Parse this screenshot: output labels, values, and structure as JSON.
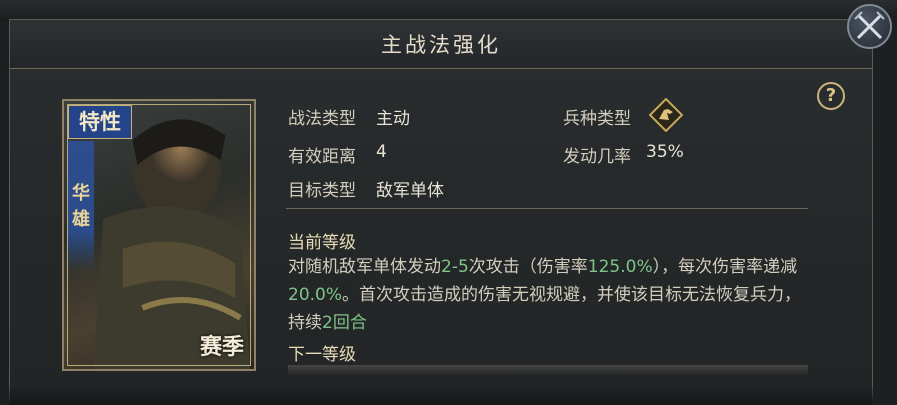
{
  "dialog": {
    "title": "主战法强化"
  },
  "card": {
    "trait": "特性",
    "name": "华雄",
    "season": "赛季"
  },
  "stats": {
    "tactic_type_label": "战法类型",
    "tactic_type_value": "主动",
    "range_label": "有效距离",
    "range_value": "4",
    "target_label": "目标类型",
    "target_value": "敌军单体",
    "troop_type_label": "兵种类型",
    "troop_type_icon": "troop-type-icon",
    "trigger_rate_label": "发动几率",
    "trigger_rate_value": "35%"
  },
  "current_level": {
    "heading": "当前等级",
    "desc_parts": [
      "对随机敌军单体发动",
      "2-5",
      "次攻击（伤害率",
      "125.0%",
      "），每次伤害率递减",
      "20.0%",
      "。首次攻击造成的伤害无视规避，并使该目标无法恢复兵力，持续",
      "2回合"
    ]
  },
  "next_level": {
    "heading": "下一等级"
  },
  "colors": {
    "highlight": "#7fc48b",
    "accent": "#d9c48a",
    "badge": "#24448a"
  }
}
